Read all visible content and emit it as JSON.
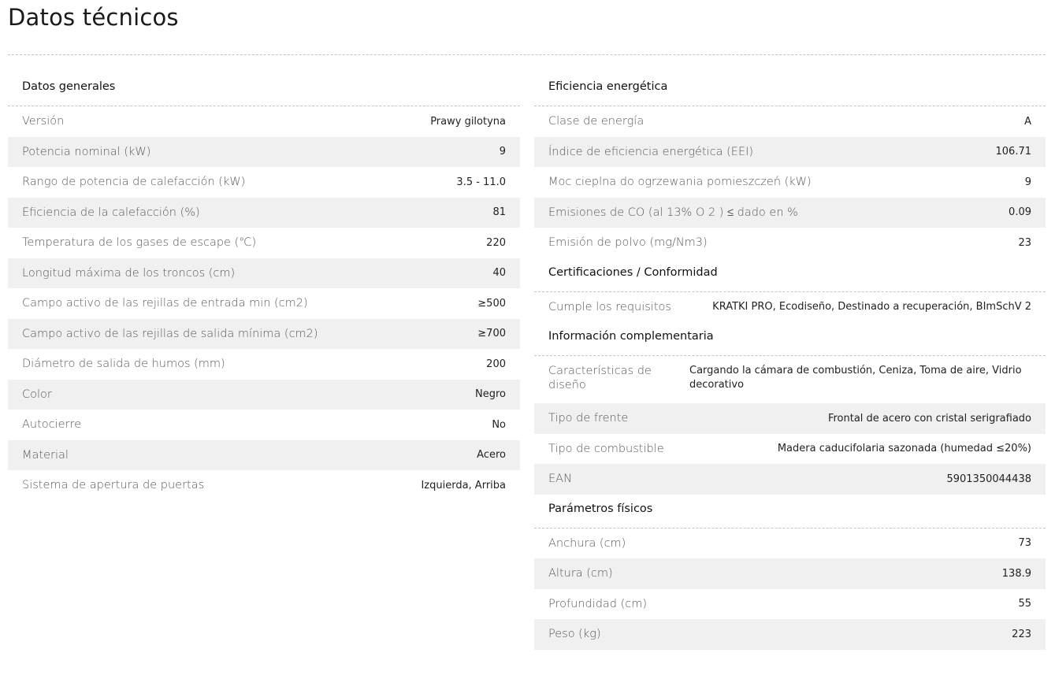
{
  "title": "Datos técnicos",
  "left": {
    "heading": "Datos generales",
    "rows": [
      {
        "label": "Versión",
        "value": "Prawy gilotyna"
      },
      {
        "label": "Potencia nominal (kW)",
        "value": "9"
      },
      {
        "label": "Rango de potencia de calefacción (kW)",
        "value": "3.5 - 11.0"
      },
      {
        "label": "Eficiencia de la calefacción (%)",
        "value": "81"
      },
      {
        "label": "Temperatura de los gases de escape (℃)",
        "value": "220"
      },
      {
        "label": "Longitud máxima de los troncos (cm)",
        "value": "40"
      },
      {
        "label": "Campo activo de las rejillas de entrada min (cm2)",
        "value": "≥500"
      },
      {
        "label": "Campo activo de las rejillas de salida mínima (cm2)",
        "value": "≥700"
      },
      {
        "label": "Diámetro de salida de humos (mm)",
        "value": "200"
      },
      {
        "label": "Color",
        "value": "Negro"
      },
      {
        "label": "Autocierre",
        "value": "No"
      },
      {
        "label": "Material",
        "value": "Acero"
      },
      {
        "label": "Sistema de apertura de puertas",
        "value": "Izquierda, Arriba"
      }
    ]
  },
  "right": {
    "efficiency": {
      "heading": "Eficiencia energética",
      "rows": [
        {
          "label": "Clase de energía",
          "value": "A"
        },
        {
          "label": "Índice de eficiencia energética (EEI)",
          "value": "106.71"
        },
        {
          "label": "Moc cieplna do ogrzewania pomieszczeń (kW)",
          "value": "9"
        },
        {
          "label": "Emisiones de CO (al 13% O 2 ) ≤ dado en %",
          "value": "0.09"
        },
        {
          "label": "Emisión de polvo (mg/Nm3)",
          "value": "23"
        }
      ]
    },
    "certifications": {
      "heading": "Certificaciones / Conformidad",
      "rows": [
        {
          "label": "Cumple los requisitos",
          "value": "KRATKI PRO, Ecodiseño, Destinado a recuperación, BImSchV 2"
        }
      ]
    },
    "complementary": {
      "heading": "Información complementaria",
      "rows": [
        {
          "label": "Características de diseño",
          "value": "Cargando la cámara de combustión, Ceniza, Toma de aire, Vidrio decorativo"
        },
        {
          "label": "Tipo de frente",
          "value": "Frontal de acero con cristal serigrafiado"
        },
        {
          "label": "Tipo de combustible",
          "value": "Madera caducifolaria sazonada (humedad ≤20%)"
        },
        {
          "label": "EAN",
          "value": "5901350044438"
        }
      ]
    },
    "physical": {
      "heading": "Parámetros físicos",
      "rows": [
        {
          "label": "Anchura (cm)",
          "value": "73"
        },
        {
          "label": "Altura (cm)",
          "value": "138.9"
        },
        {
          "label": "Profundidad (cm)",
          "value": "55"
        },
        {
          "label": "Peso (kg)",
          "value": "223"
        }
      ]
    }
  }
}
